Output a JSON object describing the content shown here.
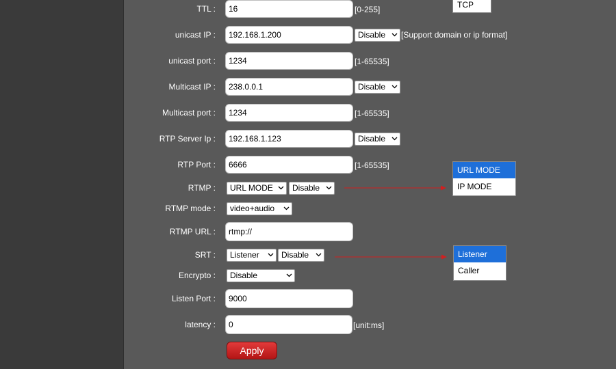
{
  "fields": {
    "ttl": {
      "label": "TTL :",
      "value": "16",
      "hint": "[0-255]"
    },
    "unicast_ip": {
      "label": "unicast IP :",
      "value": "192.168.1.200",
      "select": "Disable",
      "hint": "[Support domain or ip format]"
    },
    "unicast_port": {
      "label": "unicast port :",
      "value": "1234",
      "hint": "[1-65535]"
    },
    "multicast_ip": {
      "label": "Multicast IP :",
      "value": "238.0.0.1",
      "select": "Disable"
    },
    "multicast_port": {
      "label": "Multicast port :",
      "value": "1234",
      "hint": "[1-65535]"
    },
    "rtp_server_ip": {
      "label": "RTP Server Ip :",
      "value": "192.168.1.123",
      "select": "Disable"
    },
    "rtp_port": {
      "label": "RTP Port :",
      "value": "6666",
      "hint": "[1-65535]"
    },
    "rtmp": {
      "label": "RTMP :",
      "mode_select": "URL MODE",
      "enable_select": "Disable"
    },
    "rtmp_mode": {
      "label": "RTMP mode :",
      "select": "video+audio"
    },
    "rtmp_url": {
      "label": "RTMP URL :",
      "value": "rtmp://"
    },
    "srt": {
      "label": "SRT :",
      "mode_select": "Listener",
      "enable_select": "Disable"
    },
    "encrypto": {
      "label": "Encrypto :",
      "select": "Disable"
    },
    "listen_port": {
      "label": "Listen Port :",
      "value": "9000"
    },
    "latency": {
      "label": "latency :",
      "value": "0",
      "hint": "[unit:ms]"
    }
  },
  "apply_label": "Apply",
  "popups": {
    "top_partial": {
      "options": [
        "TCP"
      ]
    },
    "rtmp_mode_options": {
      "options": [
        "URL MODE",
        "IP MODE"
      ],
      "highlighted": "URL MODE"
    },
    "srt_mode_options": {
      "options": [
        "Listener",
        "Caller"
      ],
      "highlighted": "Listener"
    }
  },
  "colors": {
    "background": "#595959",
    "sidebar": "#3a3a3a",
    "highlight": "#1e6fd9",
    "arrow": "#d02020",
    "apply": "#c42020"
  }
}
